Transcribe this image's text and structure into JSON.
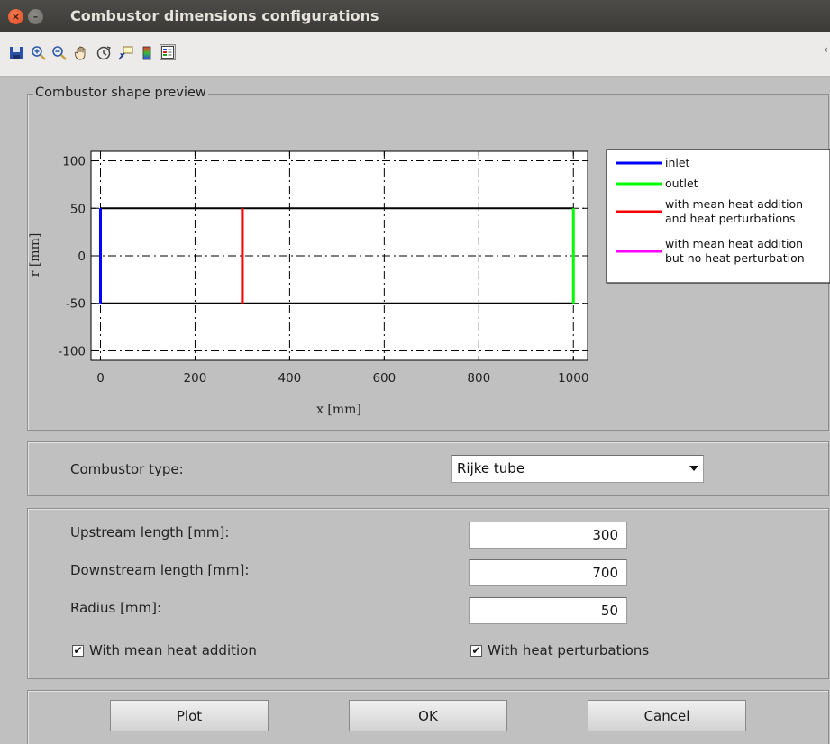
{
  "window": {
    "title": "Combustor dimensions configurations",
    "close_glyph": "×",
    "minimize_glyph": "–"
  },
  "toolbar": {
    "icons": [
      "save-icon",
      "zoom-in-icon",
      "zoom-out-icon",
      "pan-hand-icon",
      "rotate-3d-icon",
      "data-cursor-icon",
      "colorbar-icon",
      "legend-icon"
    ],
    "overflow": "‹"
  },
  "preview": {
    "title": "Combustor shape preview",
    "legend": [
      {
        "lines": [
          "inlet"
        ],
        "color": "#0000ff"
      },
      {
        "lines": [
          "outlet"
        ],
        "color": "#00ff00"
      },
      {
        "lines": [
          "with mean heat addition",
          "and heat perturbations"
        ],
        "color": "#ff0000"
      },
      {
        "lines": [
          "with mean heat addition",
          "but no heat perturbation"
        ],
        "color": "#ff00ff"
      }
    ]
  },
  "chart_data": {
    "type": "line",
    "xlabel": "x [mm]",
    "ylabel": "r [mm]",
    "xlim": [
      -20,
      1030
    ],
    "ylim": [
      -110,
      110
    ],
    "xticks": [
      0,
      200,
      400,
      600,
      800,
      1000
    ],
    "yticks": [
      100,
      50,
      0,
      -50,
      -100
    ],
    "grid": true,
    "grid_style": "dash-dot",
    "legend_position": "outside-right",
    "series": [
      {
        "name": "",
        "color": "#000000",
        "x": [
          0,
          1000
        ],
        "y": [
          50,
          50
        ]
      },
      {
        "name": "",
        "color": "#000000",
        "x": [
          0,
          1000
        ],
        "y": [
          -50,
          -50
        ]
      },
      {
        "name": "inlet",
        "color": "#0000ff",
        "x": [
          0,
          0
        ],
        "y": [
          -50,
          50
        ]
      },
      {
        "name": "outlet",
        "color": "#00ff00",
        "x": [
          1000,
          1000
        ],
        "y": [
          -50,
          50
        ]
      },
      {
        "name": "with mean heat addition and heat perturbations",
        "color": "#ff0000",
        "x": [
          300,
          300
        ],
        "y": [
          -50,
          50
        ]
      }
    ]
  },
  "combustor": {
    "type_label": "Combustor type:",
    "type_value": "Rijke tube"
  },
  "dimensions": {
    "upstream_label": "Upstream length [mm]:",
    "upstream_value": "300",
    "downstream_label": "Downstream length [mm]:",
    "downstream_value": "700",
    "radius_label": "Radius [mm]:",
    "radius_value": "50",
    "mean_heat_label": "With mean heat addition",
    "mean_heat_checked": true,
    "heat_pert_label": "With heat perturbations",
    "heat_pert_checked": true,
    "check_glyph": "✔"
  },
  "buttons": {
    "plot": "Plot",
    "ok": "OK",
    "cancel": "Cancel"
  }
}
